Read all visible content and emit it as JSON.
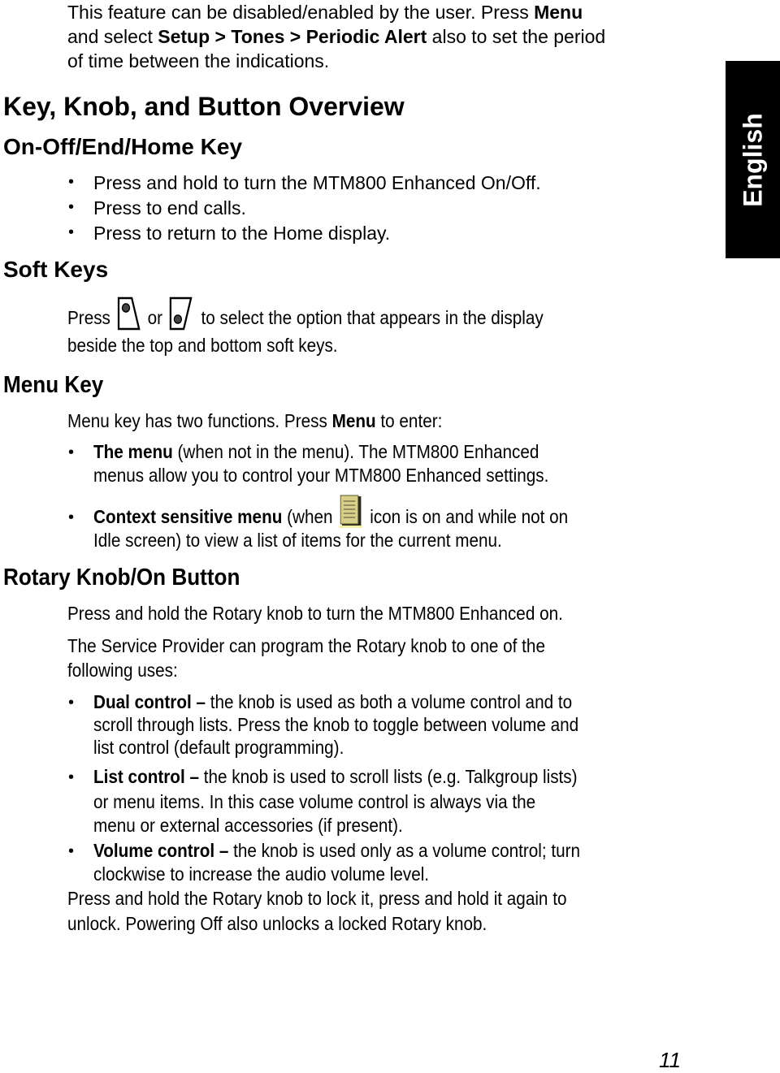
{
  "side_tab": {
    "label": "English"
  },
  "intro": {
    "line1_a": "This feature can be disabled/enabled by the user. Press ",
    "line1_b": "Menu",
    "line2_a": "and select ",
    "line2_b": "Setup > Tones > Periodic Alert",
    "line2_c": " also to set the period",
    "line3": "of time between the indications."
  },
  "main_heading": "Key, Knob, and Button Overview",
  "on_off": {
    "heading": "On-Off/End/Home Key",
    "bullets": [
      "Press and hold to turn the MTM800 Enhanced On/Off.",
      "Press to end calls.",
      "Press to return to the Home display."
    ]
  },
  "soft_keys": {
    "heading": "Soft Keys",
    "text_press": "Press",
    "text_or": "or",
    "text_rest": "to select the option that appears in the display",
    "text_line2": "beside the top and bottom soft keys.",
    "icons": [
      "top-soft-key-icon",
      "bottom-soft-key-icon"
    ]
  },
  "menu_key": {
    "heading": "Menu Key",
    "intro_a": "Menu key has two functions. Press ",
    "intro_b": "Menu",
    "intro_c": " to enter:",
    "item1_bold": "The menu",
    "item1_rest": " (when not in the menu). The MTM800 Enhanced",
    "item1_line2": "menus allow you to control your MTM800 Enhanced settings.",
    "item2_bold": "Context sensitive menu",
    "item2_a": " (when ",
    "item2_b": " icon is on and while not on",
    "item2_line2": "Idle screen) to view a list of items for the current menu.",
    "icon": "context-menu-icon"
  },
  "rotary": {
    "heading": "Rotary Knob/On Button",
    "para1": "Press and hold the Rotary knob to turn the MTM800 Enhanced on.",
    "para2_line1": "The Service Provider can program the Rotary knob to one of the",
    "para2_line2": "following uses:",
    "items": [
      {
        "bold": "Dual control –",
        "line1": " the knob is used as both a volume control and to",
        "line2": "scroll through lists. Press the knob to toggle between volume and",
        "line3": "list control (default programming)."
      },
      {
        "bold": "List control –",
        "line1": " the knob is used to scroll lists (e.g. Talkgroup lists)",
        "line2": "or menu items. In this case volume control is always via the",
        "line3": "menu or external accessories (if present)."
      },
      {
        "bold": "Volume control –",
        "line1": " the knob is used only as a volume control; turn",
        "line2": "clockwise to increase the audio volume level."
      }
    ],
    "closing_line1": "Press and hold the Rotary knob to lock it, press and hold it again to",
    "closing_line2": "unlock. Powering Off also unlocks a locked Rotary knob."
  },
  "page_number": "11"
}
